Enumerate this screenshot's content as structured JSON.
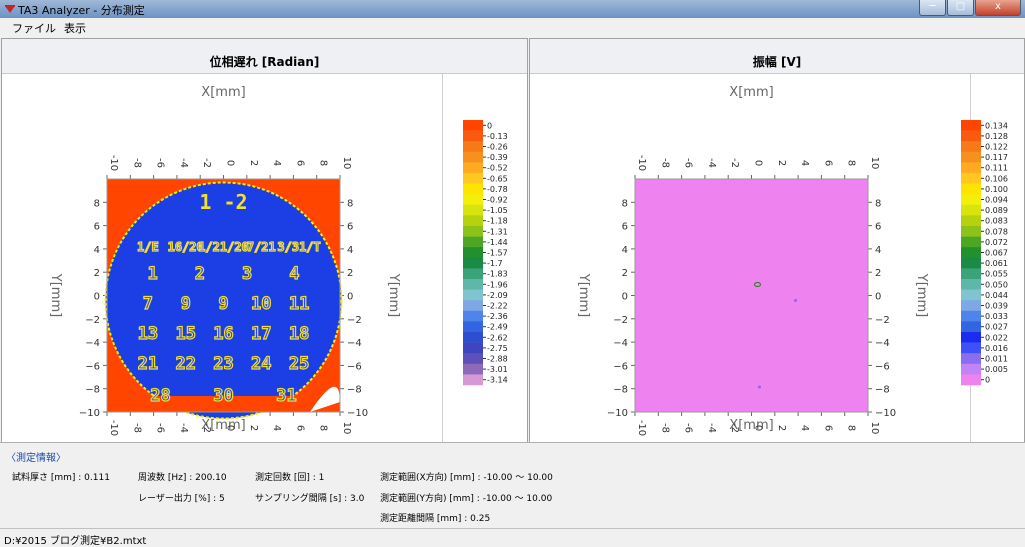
{
  "window": {
    "title": "TA3 Analyzer - 分布測定",
    "minimize_label": "─",
    "maximize_label": "▢",
    "close_label": "x"
  },
  "menu": {
    "file": "ファイル",
    "view": "表示"
  },
  "panel_left": {
    "title": "位相遅れ [Radian]",
    "xlabel": "X[mm]",
    "ylabel": "Y[mm]",
    "ticks": [
      "-10",
      "-8",
      "-6",
      "-4",
      "-2",
      "0",
      "2",
      "4",
      "6",
      "8"
    ],
    "xticks_top": [
      "10",
      "8",
      "6",
      "4",
      "2",
      "0",
      "-2",
      "-4",
      "-6",
      "-8",
      "-10"
    ],
    "yticks": [
      "8",
      "6",
      "4",
      "2",
      "0",
      "-2",
      "-4",
      "-6",
      "-8",
      "-10"
    ],
    "legend": [
      "0",
      "-0.13",
      "-0.26",
      "-0.39",
      "-0.52",
      "-0.65",
      "-0.78",
      "-0.92",
      "-1.05",
      "-1.18",
      "-1.31",
      "-1.44",
      "-1.57",
      "-1.7",
      "-1.83",
      "-1.96",
      "-2.09",
      "-2.22",
      "-2.36",
      "-2.49",
      "-2.62",
      "-2.75",
      "-2.88",
      "-3.01",
      "-3.14"
    ],
    "calendar_rows": [
      [
        "1/E",
        "16/20",
        "1/21/20",
        "7/21",
        "3/31/T"
      ],
      [
        "1",
        "2",
        "3",
        "4"
      ],
      [
        "7",
        "9",
        "9",
        "10",
        "11"
      ],
      [
        "13",
        "15",
        "16",
        "17",
        "18"
      ],
      [
        "21",
        "22",
        "23",
        "24",
        "25"
      ],
      [
        "28",
        "30",
        "31"
      ]
    ],
    "header_text": "1 -2"
  },
  "panel_right": {
    "title": "振幅 [V]",
    "xlabel": "X[mm]",
    "ylabel": "Y[mm]",
    "legend": [
      "0.134",
      "0.128",
      "0.122",
      "0.117",
      "0.111",
      "0.106",
      "0.100",
      "0.094",
      "0.089",
      "0.083",
      "0.078",
      "0.072",
      "0.067",
      "0.061",
      "0.055",
      "0.050",
      "0.044",
      "0.039",
      "0.033",
      "0.027",
      "0.022",
      "0.016",
      "0.011",
      "0.005",
      "0"
    ]
  },
  "colors": {
    "left_legend": [
      "#ff4500",
      "#fa5a10",
      "#f77a18",
      "#f89020",
      "#ffaa20",
      "#ffc820",
      "#ffe400",
      "#f4ef0a",
      "#d7e40e",
      "#b6d20e",
      "#8cc21a",
      "#4ca624",
      "#22902c",
      "#1a8a44",
      "#3aa37a",
      "#5eb7a8",
      "#80c4cf",
      "#7da8e5",
      "#4f84ea",
      "#3364e2",
      "#2d4fcf",
      "#3d46c0",
      "#5e50ba",
      "#8d6ab9",
      "#d59ad6"
    ],
    "right_legend": [
      "#ff4500",
      "#fa5a10",
      "#f77a18",
      "#f89020",
      "#ffaa20",
      "#ffc820",
      "#ffe400",
      "#f4ef0a",
      "#d7e40e",
      "#b6d20e",
      "#8cc21a",
      "#4ca624",
      "#22902c",
      "#1a8a44",
      "#3aa37a",
      "#5eb7a8",
      "#80c4cf",
      "#7da8e5",
      "#4f84ea",
      "#3364e2",
      "#1c2bf0",
      "#4050f8",
      "#8a6ef0",
      "#c084f4",
      "#ee82ee"
    ],
    "phase_bg": "#ff4500",
    "phase_blue": "#1c3ee5",
    "amp_bg": "#ee82ee",
    "info_title": "#1d4aa8"
  },
  "info": {
    "heading": "〈測定情報〉",
    "thickness": "試料厚さ [mm] : 0.111",
    "frequency": "周波数 [Hz] : 200.10",
    "laser": "レーザー出力 [%] : 5",
    "count": "測定回数 [回] : 1",
    "sampling": "サンプリング間隔 [s] : 3.0",
    "range_x": "測定範囲(X方向) [mm] : -10.00 ～ 10.00",
    "range_y": "測定範囲(Y方向) [mm] : -10.00 ～ 10.00",
    "pitch": "測定距離間隔 [mm] : 0.25"
  },
  "status": {
    "path": "D:¥2015 ブログ測定¥B2.mtxt"
  }
}
